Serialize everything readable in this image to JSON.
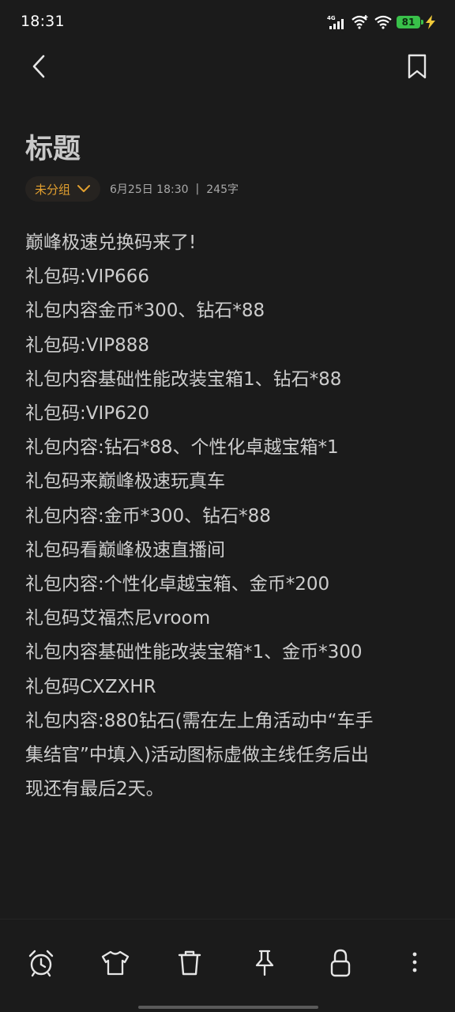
{
  "status_bar": {
    "time": "18:31",
    "network": "4G",
    "battery": "81"
  },
  "icons": {
    "back": "chevron-left-icon",
    "bookmark": "bookmark-icon",
    "alarm": "alarm-clock-icon",
    "theme": "tshirt-icon",
    "delete": "trash-icon",
    "pin": "pin-icon",
    "lock": "lock-icon",
    "more": "more-vertical-icon"
  },
  "note": {
    "title": "标题",
    "group_label": "未分组",
    "date": "6月25日 18:30",
    "separator": "|",
    "word_count": "245字",
    "lines": [
      "巅峰极速兑换码来了!",
      "礼包码:VIP666",
      "礼包内容金币*300、钻石*88",
      "礼包码:VIP888",
      "礼包内容基础性能改装宝箱1、钻石*88",
      "礼包码:VIP620",
      "礼包内容:钻石*88、个性化卓越宝箱*1",
      "礼包码来巅峰极速玩真车",
      "礼包内容:金币*300、钻石*88",
      "礼包码看巅峰极速直播间",
      "礼包内容:个性化卓越宝箱、金币*200",
      "礼包码艾福杰尼vroom",
      "礼包内容基础性能改装宝箱*1、金币*300",
      "礼包码CXZXHR",
      "礼包内容:880钻石(需在左上角活动中“车手",
      "集结官”中填入)活动图标虚做主线任务后出",
      "现还有最后2天。"
    ]
  },
  "colors": {
    "background": "#1b1b1b",
    "accent": "#e3a02f",
    "battery": "#39c14a"
  }
}
